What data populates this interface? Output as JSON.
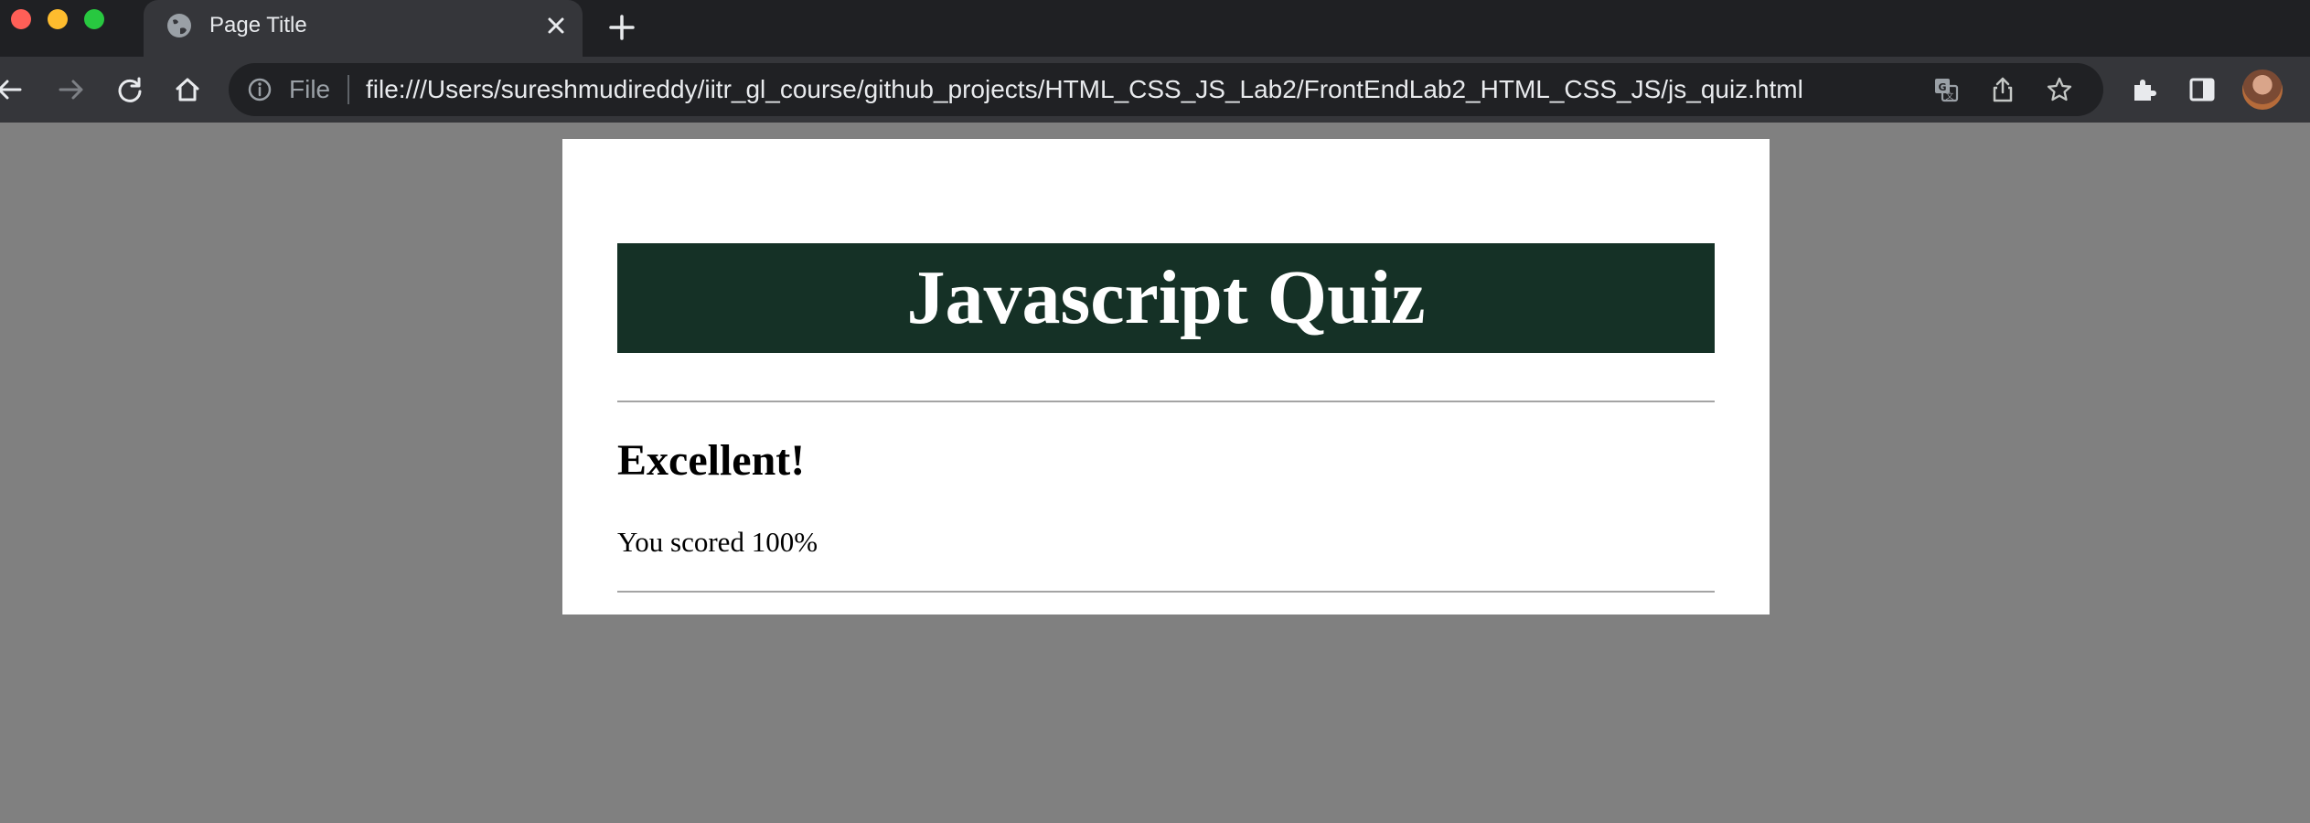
{
  "browser": {
    "tab_title": "Page Title",
    "omnibox": {
      "scheme_chip": "File",
      "url": "file:///Users/sureshmudireddy/iitr_gl_course/github_projects/HTML_CSS_JS_Lab2/FrontEndLab2_HTML_CSS_JS/js_quiz.html"
    },
    "toolbar_icons": [
      "back-icon",
      "forward-icon",
      "reload-icon",
      "home-icon",
      "info-icon",
      "translate-icon",
      "share-icon",
      "bookmark-star-icon",
      "extensions-icon",
      "side-panel-icon"
    ],
    "colors": {
      "tabstrip": "#1f2023",
      "toolbar": "#35363a",
      "omnibox": "#202124"
    }
  },
  "quiz": {
    "title": "Javascript Quiz",
    "result_heading": "Excellent!",
    "score_text": "You scored 100%",
    "score_percent": 100
  },
  "colors": {
    "viewport_background": "#808080",
    "header_background": "#153126",
    "header_text": "#ffffff"
  }
}
